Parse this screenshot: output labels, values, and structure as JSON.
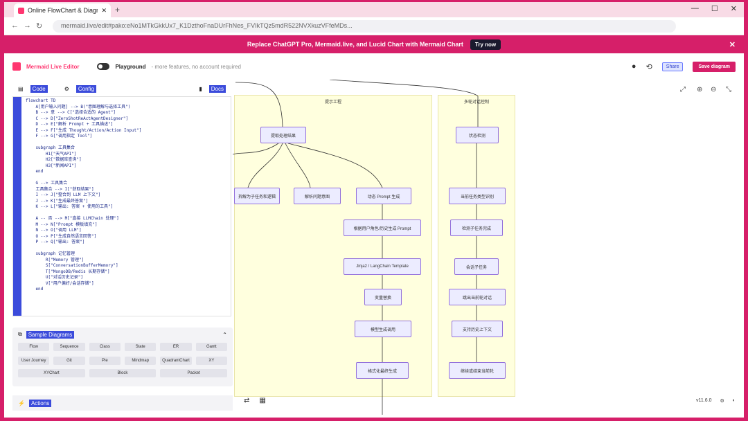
{
  "browser": {
    "tab_title": "Online FlowChart & Diagram",
    "new_tab": "+",
    "url": "mermaid.live/edit#pako:eNo1MTkGkkUx7_K1DzthoFnaDUrFhNes_FVIkTQz5mdR522NVXkuzVFfeMDs..."
  },
  "banner": {
    "text": "Replace ChatGPT Pro, Mermaid.live, and Lucid Chart with Mermaid Chart",
    "button": "Try now",
    "close": "✕"
  },
  "header": {
    "brand": "Mermaid Live Editor",
    "playground": "Playground",
    "playground_sub": "- more features, no account required",
    "share": "Share",
    "save": "Save diagram"
  },
  "editor": {
    "tab_code": "Code",
    "tab_config": "Config",
    "docs": "Docs",
    "lines": [
      "flowchart TD",
      "    A[用户输入问题] --> B(\"意图理解与选择工具\")",
      "    B --> 意 --> C[\"选择合适的 Agent\"]",
      "    C --> D[\"ZeroShotReActAgentDesigner\"]",
      "    D --> E[\"解析 Prompt + 工具描述\"]",
      "    E --> F[\"生成 Thought/Action/Action Input\"]",
      "    F --> G[\"调用指定 Tool\"]",
      "",
      "    subgraph 工具集合",
      "        H1[\"天气API\"]",
      "        H2[\"数据库查询\"]",
      "        H3[\"新闻API\"]",
      "    end",
      "",
      "    G --> 工具集合",
      "    工具集合 --> I[\"获取结果\"]",
      "    I --> J[\"整合到 LLM 上下文\"]",
      "    J --> K[\"生成最终答案\"]",
      "    K --> L[\"输出: 答案 + 使用的工具\"]",
      "",
      "    A -- 否 --> M[\"直接 LLMChain 处理\"]",
      "    M --> N[\"Prompt 模板填充\"]",
      "    N --> O[\"调用 LLM\"]",
      "    O --> P[\"生成自然语言回答\"]",
      "    P --> Q[\"输出: 答案\"]",
      "",
      "    subgraph 记忆管理",
      "        R[\"Memory 管理\"]",
      "        S[\"ConversationBufferMemory\"]",
      "        T[\"MongoDB/Redis 长期存储\"]",
      "        U[\"对话历史记录\"]",
      "        V[\"用户偏好/会话存储\"]",
      "    end"
    ]
  },
  "sample": {
    "title": "Sample Diagrams",
    "row1": [
      "Flow",
      "Sequence",
      "Class",
      "State",
      "ER",
      "Gantt"
    ],
    "row2": [
      "User Journey",
      "Git",
      "Pie",
      "Mindmap",
      "QuadrantChart",
      "XY"
    ],
    "row3": [
      "XYChart",
      "Block",
      "Packet"
    ]
  },
  "actions": {
    "title": "Actions"
  },
  "diagram": {
    "sg_left_title": "提示工程",
    "sg_right_title": "多轮对话控制",
    "nodes": {
      "top": "提取处理结果",
      "b1": "拆解为子任务和逻辑",
      "b2": "解析问题意图",
      "b3": "动态 Prompt 生成",
      "c1": "根据用户角色/历史生成 Prompt",
      "c2": "Jinja2 / LangChain Template",
      "c3": "变量替换",
      "c4": "模型生成调用",
      "c5": "格式化最终生成",
      "r1": "状态检测",
      "r2": "当前任务类型识别",
      "r3": "检测子任务完成",
      "r4": "会话子任务",
      "r5": "跳出当前轮对话",
      "r6": "支持历史上下文",
      "r7": "继续或结束当前轮"
    },
    "version": "v11.6.0"
  }
}
